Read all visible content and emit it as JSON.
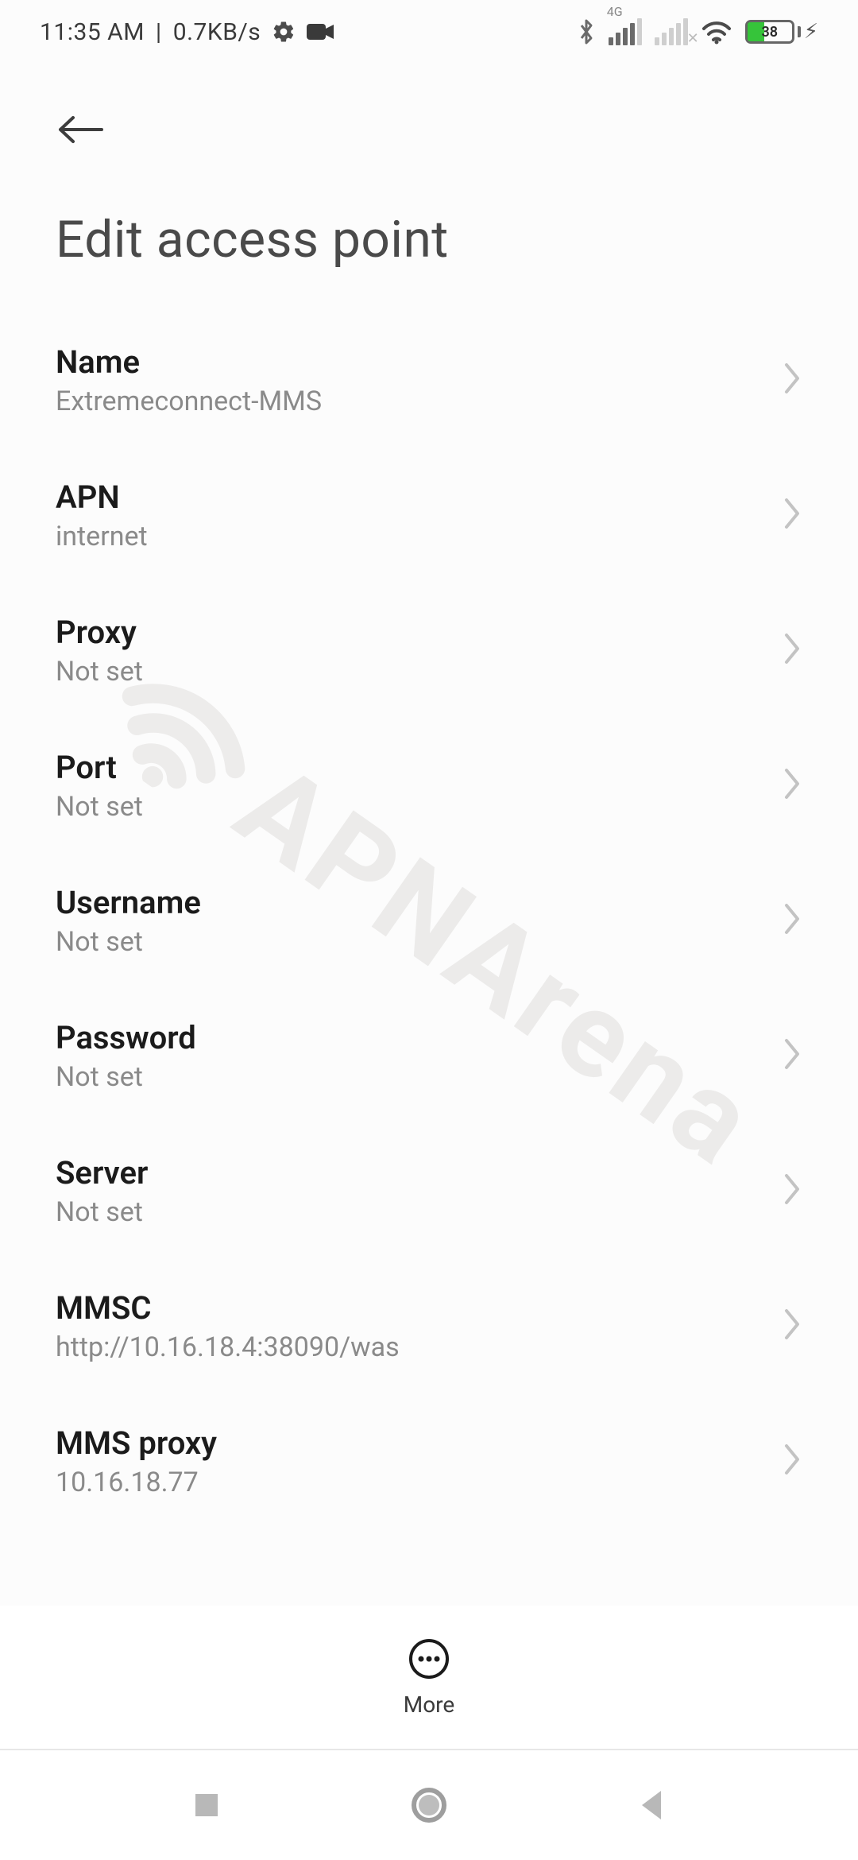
{
  "status": {
    "time": "11:35 AM",
    "separator": "|",
    "net_speed": "0.7KB/s",
    "signal_label": "4G",
    "battery_percent": "38"
  },
  "header": {
    "title": "Edit access point"
  },
  "fields": [
    {
      "label": "Name",
      "value": "Extremeconnect-MMS"
    },
    {
      "label": "APN",
      "value": "internet"
    },
    {
      "label": "Proxy",
      "value": "Not set"
    },
    {
      "label": "Port",
      "value": "Not set"
    },
    {
      "label": "Username",
      "value": "Not set"
    },
    {
      "label": "Password",
      "value": "Not set"
    },
    {
      "label": "Server",
      "value": "Not set"
    },
    {
      "label": "MMSC",
      "value": "http://10.16.18.4:38090/was"
    },
    {
      "label": "MMS proxy",
      "value": "10.16.18.77"
    }
  ],
  "action_bar": {
    "more_label": "More"
  },
  "watermark": {
    "text": "APNArena"
  }
}
